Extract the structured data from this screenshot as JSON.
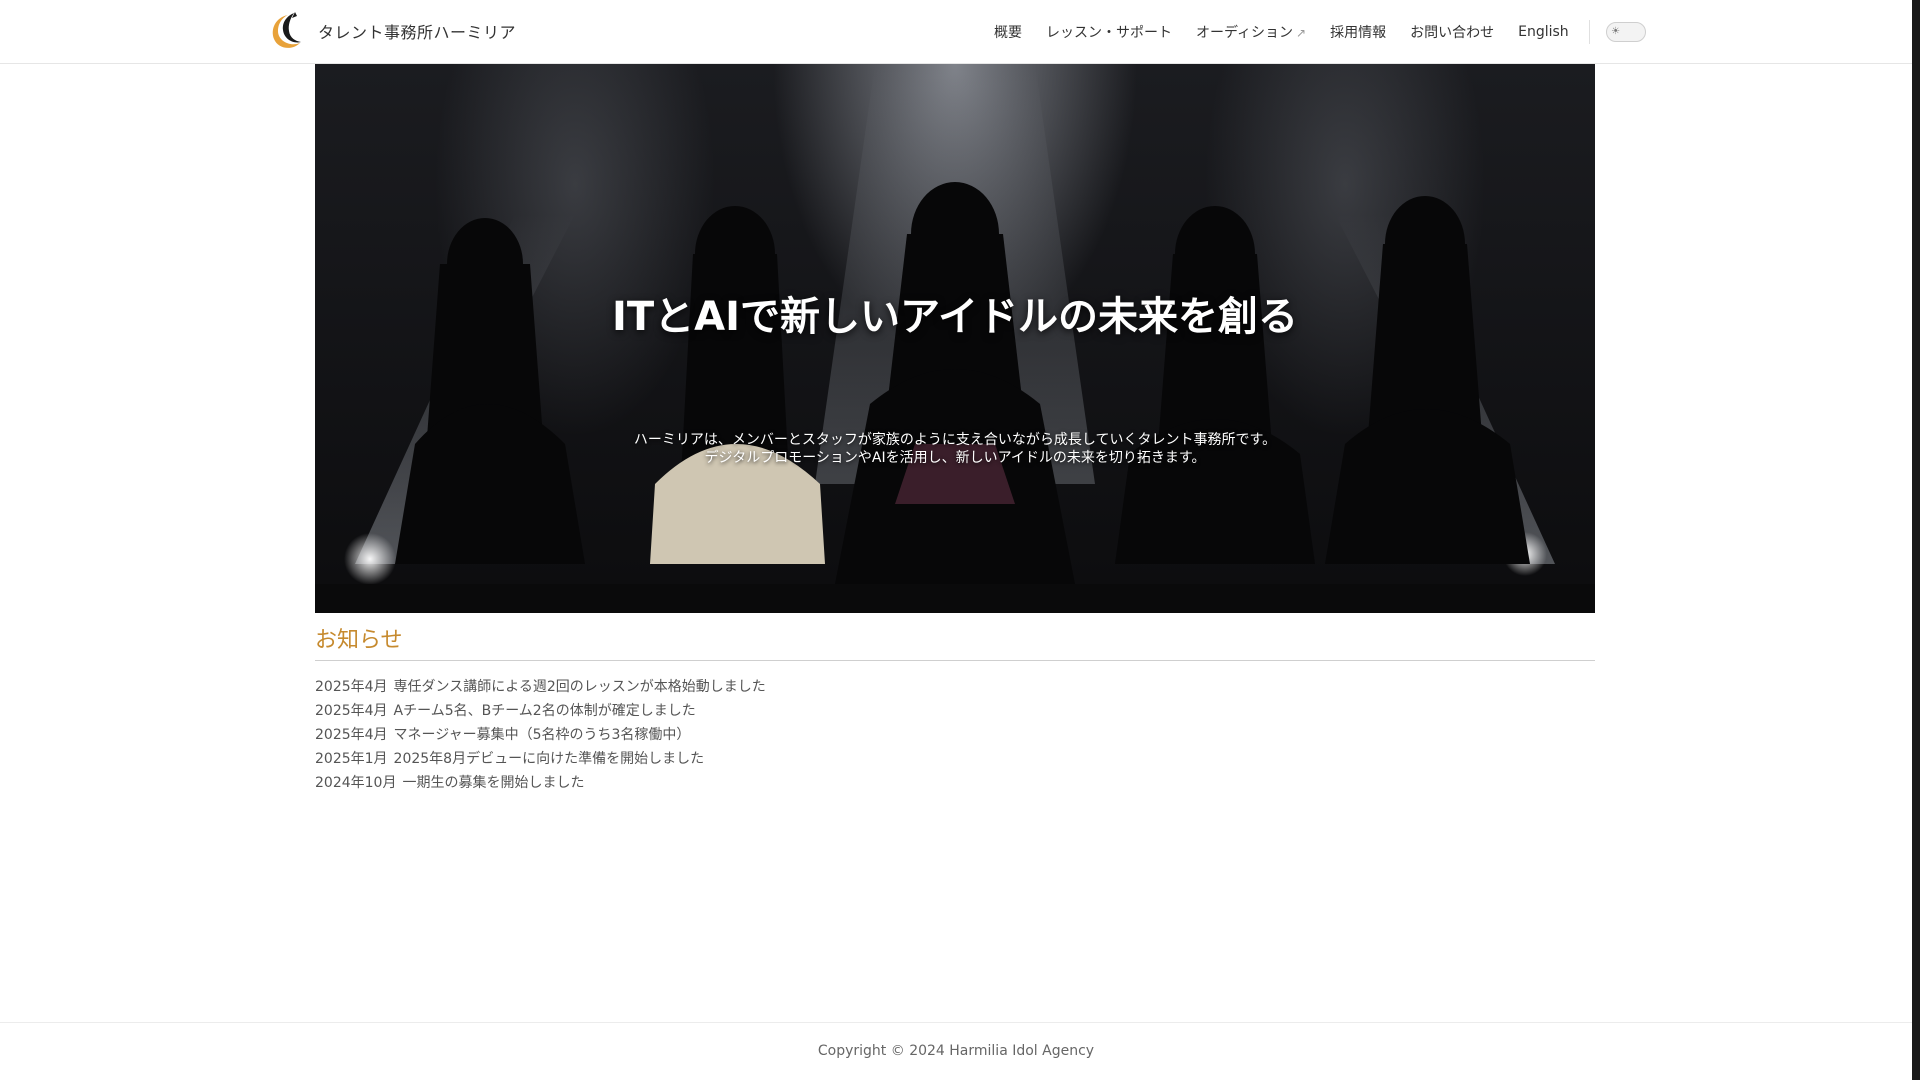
{
  "header": {
    "brand_name": "タレント事務所ハーミリア",
    "nav": [
      {
        "label": "概要"
      },
      {
        "label": "レッスン・サポート"
      },
      {
        "label": "オーディション",
        "external_mark": "↗"
      },
      {
        "label": "採用情報"
      },
      {
        "label": "お問い合わせ"
      },
      {
        "label": "English"
      }
    ],
    "theme_toggle_icon": "sun-icon",
    "theme_toggle_glyph": "☀"
  },
  "hero": {
    "title": "ITとAIで新しいアイドルの未来を創る",
    "subtitle_line1": "ハーミリアは、メンバーとスタッフが家族のように支え合いながら成長していくタレント事務所です。",
    "subtitle_line2": "デジタルプロモーションやAIを活用し、新しいアイドルの未来を切り拓きます。"
  },
  "news": {
    "title": "お知らせ",
    "items": [
      {
        "date": "2025年4月",
        "text": "専任ダンス講師による週2回のレッスンが本格始動しました"
      },
      {
        "date": "2025年4月",
        "text": "Aチーム5名、Bチーム2名の体制が確定しました"
      },
      {
        "date": "2025年4月",
        "text": "マネージャー募集中（5名枠のうち3名稼働中）"
      },
      {
        "date": "2025年1月",
        "text": "2025年8月デビューに向けた準備を開始しました"
      },
      {
        "date": "2024年10月",
        "text": "一期生の募集を開始しました"
      }
    ]
  },
  "footer": {
    "copyright": "Copyright © 2024 Harmilia Idol Agency"
  },
  "colors": {
    "accent": "#c68a2e",
    "logo_gold": "#e8a23a",
    "hero_bg": "#111114"
  }
}
